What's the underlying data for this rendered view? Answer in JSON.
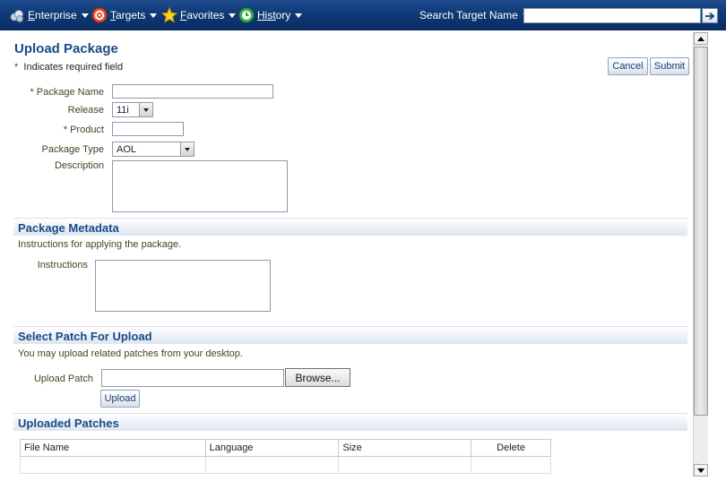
{
  "topbar": {
    "menus": [
      {
        "key": "E",
        "rest": "nterprise",
        "icon": "enterprise-icon"
      },
      {
        "key": "T",
        "rest": "argets",
        "icon": "targets-icon"
      },
      {
        "key": "F",
        "rest": "avorites",
        "icon": "favorites-star-icon"
      },
      {
        "key": "Hist",
        "rest": "ory",
        "icon": "history-icon"
      }
    ],
    "search_label": "Search Target Name",
    "search_value": ""
  },
  "page": {
    "title": "Upload Package",
    "required_marker": "*",
    "required_note": "Indicates required field",
    "cancel_label": "Cancel",
    "submit_label": "Submit"
  },
  "form": {
    "package_name_label": "Package Name",
    "package_name_value": "",
    "release_label": "Release",
    "release_value": "11i",
    "product_label": "Product",
    "product_value": "",
    "package_type_label": "Package Type",
    "package_type_value": "AOL",
    "description_label": "Description",
    "description_value": ""
  },
  "metadata": {
    "title": "Package Metadata",
    "note": "Instructions for applying the package.",
    "instructions_label": "Instructions",
    "instructions_value": ""
  },
  "patch": {
    "title": "Select Patch For Upload",
    "note": "You may upload related patches from your desktop.",
    "upload_label": "Upload Patch",
    "upload_value": "",
    "browse_label": "Browse...",
    "upload_button_label": "Upload"
  },
  "uploaded": {
    "title": "Uploaded Patches",
    "columns": [
      "File Name",
      "Language",
      "Size",
      "Delete"
    ]
  },
  "colors": {
    "topbar": "#0f3977",
    "heading": "#184b85",
    "label": "#4a3f22"
  }
}
